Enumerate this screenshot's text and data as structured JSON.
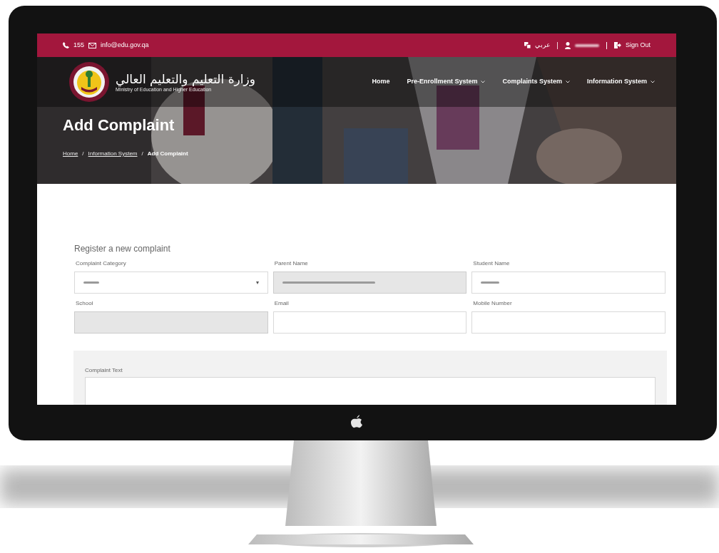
{
  "top_bar": {
    "phone": "155",
    "email": "info@edu.gov.qa",
    "language": "عربي",
    "sign_out": "Sign Out"
  },
  "logo": {
    "arabic": "وزارة التعليم والتعليم العالي",
    "english": "Ministry of Education and Higher Education"
  },
  "nav": [
    {
      "label": "Home",
      "dropdown": false
    },
    {
      "label": "Pre-Enrollment System",
      "dropdown": true
    },
    {
      "label": "Complaints System",
      "dropdown": true
    },
    {
      "label": "Information System",
      "dropdown": true
    }
  ],
  "page_title": "Add Complaint",
  "breadcrumb": {
    "separator": "/",
    "items": [
      {
        "label": "Home",
        "link": true
      },
      {
        "label": "Information System",
        "link": true
      },
      {
        "label": "Add Complaint",
        "link": false
      }
    ]
  },
  "form": {
    "heading": "Register a new complaint",
    "fields": [
      {
        "label": "Complaint Category",
        "kind": "select",
        "disabled": false,
        "value_blurred": true
      },
      {
        "label": "Parent Name",
        "kind": "text",
        "disabled": true,
        "value_blurred": true
      },
      {
        "label": "Student Name",
        "kind": "text",
        "disabled": false,
        "value_blurred": true
      },
      {
        "label": "School",
        "kind": "text",
        "disabled": true,
        "value_blurred": false
      },
      {
        "label": "Email",
        "kind": "text",
        "disabled": false,
        "value_blurred": false
      },
      {
        "label": "Mobile Number",
        "kind": "text",
        "disabled": false,
        "value_blurred": false
      }
    ],
    "text_area": {
      "label": "Complaint Text"
    }
  }
}
